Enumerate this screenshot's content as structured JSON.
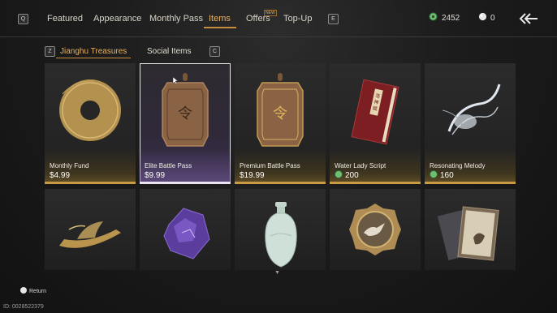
{
  "keys": {
    "left": "Q",
    "right": "E",
    "sub_left": "Z",
    "sub_right": "C"
  },
  "tabs": [
    {
      "label": "Featured"
    },
    {
      "label": "Appearance"
    },
    {
      "label": "Monthly Pass"
    },
    {
      "label": "Items"
    },
    {
      "label": "Offers"
    },
    {
      "label": "Top-Up"
    }
  ],
  "new_badge": "NEW",
  "active_tab": "Items",
  "currency": {
    "jade": {
      "value": "2452",
      "icon": "jade-coin-icon",
      "color": "#6fbf73"
    },
    "pearl": {
      "value": "0",
      "icon": "pearl-icon",
      "color": "#e6e6e6"
    }
  },
  "subtabs": [
    {
      "label": "Jianghu Treasures"
    },
    {
      "label": "Social Items"
    }
  ],
  "items": [
    {
      "name": "Monthly Fund",
      "price": "$4.99",
      "icon": "golden-disc-icon"
    },
    {
      "name": "Elite Battle Pass",
      "price": "$9.99",
      "icon": "bronze-token-icon",
      "selected": true
    },
    {
      "name": "Premium Battle Pass",
      "price": "$19.99",
      "icon": "bronze-token-icon"
    },
    {
      "name": "Water Lady Script",
      "price": "200",
      "currency": "jade",
      "icon": "red-book-icon"
    },
    {
      "name": "Resonating Melody",
      "price": "160",
      "currency": "jade",
      "icon": "silver-wisp-icon"
    }
  ],
  "items_row2": [
    {
      "icon": "golden-boat-icon"
    },
    {
      "icon": "purple-crystal-icon"
    },
    {
      "icon": "celadon-vase-icon"
    },
    {
      "icon": "dove-token-icon"
    },
    {
      "icon": "scroll-books-icon"
    }
  ],
  "footer": {
    "return_label": "Return",
    "player_id": "ID: 0028522379"
  },
  "colors": {
    "accent": "#e6b15f",
    "card_bar": "#c79a43",
    "selected_outline": "#e7e7e7"
  }
}
